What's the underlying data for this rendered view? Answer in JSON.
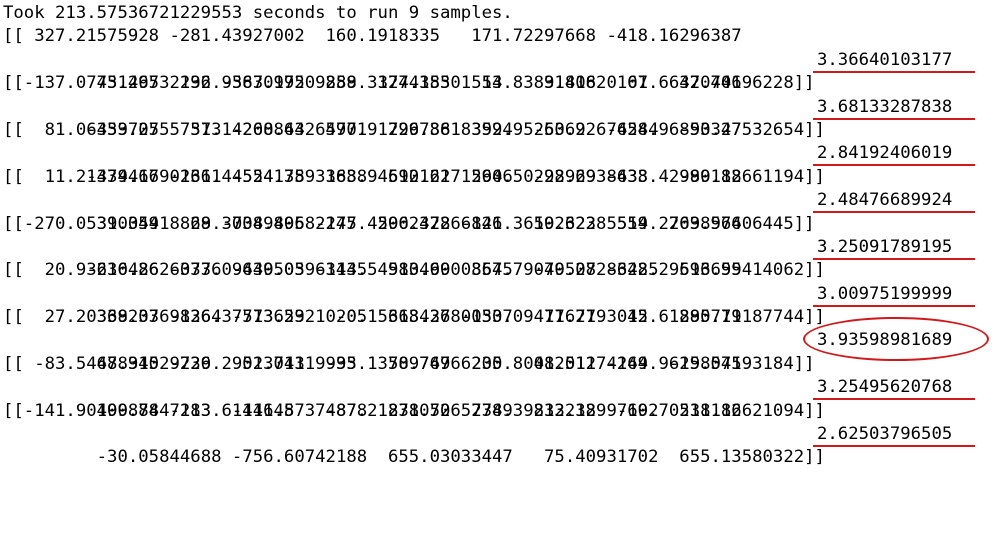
{
  "console": {
    "header": "Took 213.57536721229553 seconds to run 9 samples.",
    "samples": [
      {
        "line1": "[[ 327.21575928 -281.43927002  160.1918335   171.72297668 -418.16296387",
        "line2": "   43.29732132 -363.19509888  327.15301514    9.81820107   37.40196228]]",
        "error": "3.36640103177",
        "mark": "underline"
      },
      {
        "line1": "[[-137.07751465  296.95870972  259.31744385   53.83831406   61.66420746",
        "line2": "  -339.27557373 -208.43264771  296.88183594  -53.92676544  -90.47532654]]",
        "error": "3.68133287838",
        "mark": "underline"
      },
      {
        "line1": "[[  81.06453705   51.14260864  590.91729736  392.9526062  -428.96853327",
        "line2": "  -334.67901611 -524.75933838  590.61712646  -28.2938633   -89.88661194]]",
        "error": "2.84192406019",
        "mark": "underline"
      },
      {
        "line1": "[[  11.21479416 -236.44554138  168.94612122  590.50292969 -438.42990112",
        "line2": "   39.34418869 -738.40582275  590.42266846   50.62385559  269.96606445]]",
        "error": "2.48476689924",
        "mark": "underline"
      },
      {
        "line1": "[[-270.05310059   28.30049896 -147.42062378 -121.36192322  514.27038574",
        "line2": "  -230.26260376 -439.05963135  513.90008545  -79.08286285  513.99414062]]",
        "error": "3.25091789195",
        "mark": "underline"
      },
      {
        "line1": "[[  20.93616486 -373.09640503 -144.54980469  367.79040527 -342.29696655",
        "line2": "   368.37698364 -573.59210205  368.26800537   77.7793045   295.11187744]]",
        "error": "3.00975199999",
        "mark": "underline"
      },
      {
        "line1": "[[  27.20339203 -126.37713623   -0.15613437 -130.09411621   12.61880779",
        "line2": "   48.91029739   51.01119995   50.76766205   48.01174164  -19.07193184]]",
        "error": "3.93598981689",
        "mark": "circle"
      },
      {
        "line1": "[[ -83.54678345 -226.29023743  -33.13789749  230.80012512 -249.96258545",
        "line2": "   100.8447113  -446.87374878  231.70657349  232.18997192  231.86621094]]",
        "error": "3.25495620768",
        "mark": "underline"
      },
      {
        "line1": "[[-141.90499878 -283.6111145   -87.21878052  278.39813232  -60.70518112",
        "line2": "   -30.05844688 -756.60742188  655.03033447   75.40931702  655.13580322]]",
        "error": "2.62503796505",
        "mark": "underline"
      }
    ]
  },
  "colors": {
    "text": "#000000",
    "background": "#ffffff",
    "annotation": "#d0191b"
  }
}
